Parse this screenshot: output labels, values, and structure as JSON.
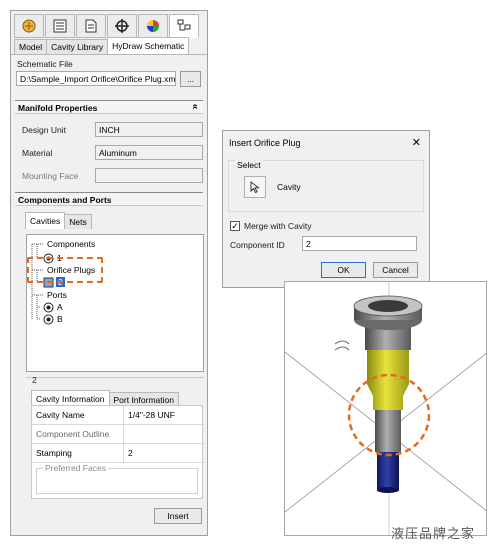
{
  "toolbar": {
    "icons": [
      "puzzle-icon",
      "properties-icon",
      "document-icon",
      "crosshair-icon",
      "color-wheel-icon",
      "schematic-icon"
    ]
  },
  "tabs": [
    "Model",
    "Cavity Library",
    "HyDraw Schematic"
  ],
  "schematic": {
    "label": "Schematic File",
    "path": "D:\\Sample_Import Orifice\\Orifice Plug.xml",
    "browse": "..."
  },
  "manifold": {
    "header": "Manifold Properties",
    "collapse_glyph": "«",
    "design_unit_label": "Design Unit",
    "design_unit_value": "INCH",
    "material_label": "Material",
    "material_value": "Aluminum",
    "mounting_face_label": "Mounting Face",
    "mounting_face_value": ""
  },
  "components": {
    "header": "Components and Ports",
    "tabs": [
      "Cavities",
      "Nets"
    ],
    "tree": {
      "components": "Components",
      "component_1": "1",
      "orifice_plugs": "Orifice Plugs",
      "orifice_2": "2",
      "ports": "Ports",
      "port_a": "A",
      "port_b": "B"
    }
  },
  "details": {
    "id": "2",
    "tabs": [
      "Cavity Information",
      "Port Information"
    ],
    "rows": [
      {
        "label": "Cavity Name",
        "value": "1/4\"-28 UNF"
      },
      {
        "label": "Component Outline",
        "value": ""
      },
      {
        "label": "Stamping",
        "value": "2"
      }
    ],
    "preferred_faces": "Preferred Faces"
  },
  "insert_button": "Insert",
  "dialog": {
    "title": "Insert Orifice Plug",
    "close": "✕",
    "select_label": "Select",
    "cavity_label": "Cavity",
    "merge_label": "Merge with Cavity",
    "merge_checked": true,
    "component_id_label": "Component ID",
    "component_id_value": "2",
    "ok": "OK",
    "cancel": "Cancel"
  },
  "watermark": "液压品牌之家",
  "colors": {
    "highlight_dashes": "#e46a1e",
    "plug_blue": "#1a2a8a",
    "cavity_yellow": "#d9d62a",
    "steel_grey": "#8a8a8a"
  }
}
